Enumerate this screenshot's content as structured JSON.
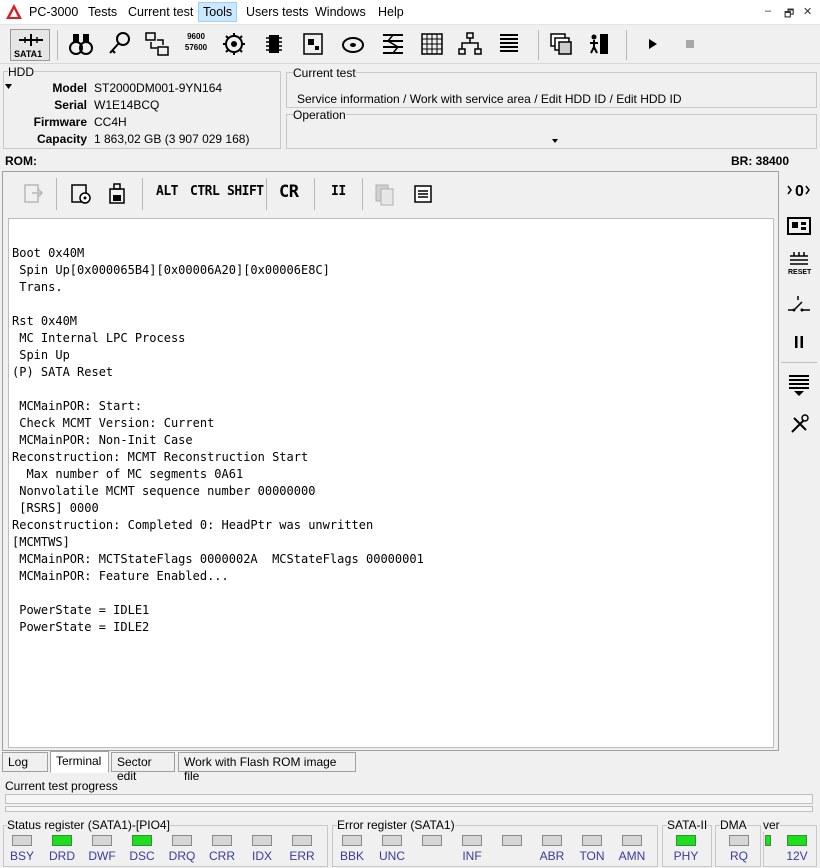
{
  "app": {
    "title": "PC-3000",
    "menu": [
      "Tests",
      "Current test",
      "Tools",
      "Users tests",
      "Windows",
      "Help"
    ],
    "active_menu": "Tools",
    "window_controls": [
      "–",
      "🗗",
      "✕"
    ]
  },
  "toolbar": {
    "sata_label": "SATA1",
    "baud_top": "9600",
    "baud_bottom": "57600"
  },
  "hdd": {
    "group_label": "HDD",
    "fields": [
      {
        "key": "Model",
        "value": "ST2000DM001-9YN164"
      },
      {
        "key": "Serial",
        "value": "W1E14BCQ"
      },
      {
        "key": "Firmware",
        "value": "CC4H"
      },
      {
        "key": "Capacity",
        "value": "1 863,02 GB (3 907 029 168)"
      }
    ]
  },
  "current_test": {
    "label": "Current test",
    "path": "Service information / Work with service area / Edit HDD ID / Edit HDD ID"
  },
  "operation": {
    "label": "Operation"
  },
  "rombar": {
    "left": "ROM:",
    "right": "BR: 38400"
  },
  "terminal_toolbar": {
    "alt": "ALT",
    "ctrl": "CTRL",
    "shift": "SHIFT",
    "cr": "CR",
    "pause": "II"
  },
  "terminal_lines": [
    "",
    "Boot 0x40M",
    " Spin Up[0x000065B4][0x00006A20][0x00006E8C]",
    " Trans.",
    "",
    "Rst 0x40M",
    " MC Internal LPC Process",
    " Spin Up",
    "(P) SATA Reset",
    "",
    " MCMainPOR: Start:",
    " Check MCMT Version: Current",
    " MCMainPOR: Non-Init Case",
    "Reconstruction: MCMT Reconstruction Start",
    "  Max number of MC segments 0A61",
    " Nonvolatile MCMT sequence number 00000000",
    " [RSRS] 0000",
    "Reconstruction: Completed 0: HeadPtr was unwritten",
    "[MCMTWS]",
    " MCMainPOR: MCTStateFlags 0000002A  MCStateFlags 00000001",
    " MCMainPOR: Feature Enabled...",
    "",
    " PowerState = IDLE1",
    " PowerState = IDLE2"
  ],
  "tabs": [
    "Log",
    "Terminal",
    "Sector edit",
    "Work with Flash ROM image file"
  ],
  "active_tab": "Terminal",
  "progress": {
    "label": "Current test progress"
  },
  "status_register": {
    "label": "Status register (SATA1)-[PIO4]",
    "leds": [
      {
        "name": "BSY",
        "on": false
      },
      {
        "name": "DRD",
        "on": true
      },
      {
        "name": "DWF",
        "on": false
      },
      {
        "name": "DSC",
        "on": true
      },
      {
        "name": "DRQ",
        "on": false
      },
      {
        "name": "CRR",
        "on": false
      },
      {
        "name": "IDX",
        "on": false
      },
      {
        "name": "ERR",
        "on": false
      }
    ]
  },
  "error_register": {
    "label": "Error register (SATA1)",
    "leds": [
      {
        "name": "BBK",
        "on": false
      },
      {
        "name": "UNC",
        "on": false
      },
      {
        "name": "",
        "on": false
      },
      {
        "name": "INF",
        "on": false
      },
      {
        "name": "",
        "on": false
      },
      {
        "name": "ABR",
        "on": false
      },
      {
        "name": "TON",
        "on": false
      },
      {
        "name": "AMN",
        "on": false
      }
    ]
  },
  "sata2": {
    "label": "SATA-II",
    "led": {
      "name": "PHY",
      "on": true
    }
  },
  "dma": {
    "label": "DMA",
    "led": {
      "name": "RQ",
      "on": false
    }
  },
  "power": {
    "label": "ver",
    "led": {
      "name": "12V",
      "on": true
    },
    "led2_on": true
  },
  "colors": {
    "led_on": "#1de01d",
    "led_off": "#d6d6d6",
    "label_blue": "#3a3aa0",
    "logo_red": "#d9202a"
  }
}
